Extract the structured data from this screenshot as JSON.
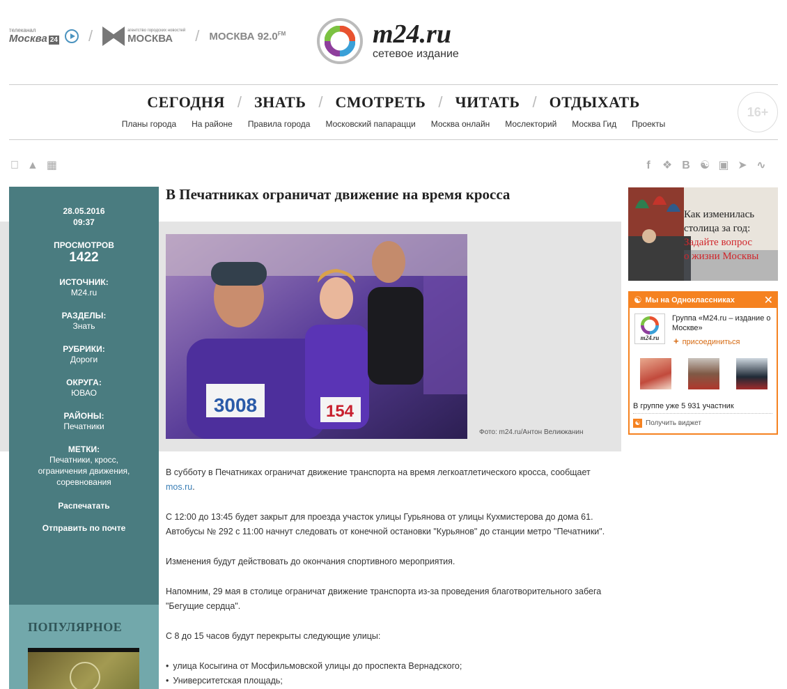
{
  "partners": {
    "tv_label": "телеканал",
    "tv_name": "Москва",
    "tv_num": "24",
    "agency_small": "агентство городских новостей",
    "agency_name": "МОСКВА",
    "radio_name": "МОСКВА 92.0",
    "radio_sup": "FM"
  },
  "logo": {
    "title": "m24.ru",
    "subtitle": "сетевое издание"
  },
  "nav": {
    "main": [
      "СЕГОДНЯ",
      "ЗНАТЬ",
      "СМОТРЕТЬ",
      "ЧИТАТЬ",
      "ОТДЫХАТЬ"
    ],
    "sub": [
      "Планы города",
      "На районе",
      "Правила города",
      "Московский папарацци",
      "Москва онлайн",
      "Мослекторий",
      "Москва Гид",
      "Проекты"
    ],
    "age_rating": "16+"
  },
  "icons": {
    "os": [
      "apple-icon",
      "android-icon",
      "windows-icon"
    ],
    "social": [
      "facebook-icon",
      "twitter-icon",
      "vk-icon",
      "odnoklassniki-icon",
      "instagram-icon",
      "telegram-icon",
      "rss-icon"
    ]
  },
  "meta": {
    "date": "28.05.2016",
    "time": "09:37",
    "views_label": "ПРОСМОТРОВ",
    "views": "1422",
    "source_label": "ИСТОЧНИК:",
    "source": "M24.ru",
    "sections_label": "РАЗДЕЛЫ:",
    "sections": "Знать",
    "rubrics_label": "РУБРИКИ:",
    "rubrics": "Дороги",
    "districts_label": "ОКРУГА:",
    "districts": "ЮВАО",
    "areas_label": "РАЙОНЫ:",
    "areas": "Печатники",
    "tags_label": "МЕТКИ:",
    "tags": "Печатники, кросс, ограничения движения, соревнования",
    "print": "Распечатать",
    "email": "Отправить по почте"
  },
  "popular": {
    "title": "ПОПУЛЯРНОЕ"
  },
  "article": {
    "title": "В Печатниках ограничат движение на время кросса",
    "photo_caption": "Фото: m24.ru/Антон Великжанин",
    "bib_numbers": [
      "3008",
      "154"
    ],
    "p1": "В субботу в Печатниках ограничат движение транспорта на время легкоатлетического кросса, сообщает",
    "p1_link": "mos.ru",
    "p1_end": ".",
    "p2": "С 12:00 до 13:45 будет закрыт для проезда участок улицы Гурьянова от улицы Кухмистерова до дома 61. Автобусы № 292 с 11:00 начнут следовать от конечной остановки \"Курьянов\" до станции метро \"Печатники\".",
    "p3": "Изменения будут действовать до окончания спортивного мероприятия.",
    "p4": "Напомним, 29 мая в столице ограничат движение транспорта из-за проведения благотворительного забега \"Бегущие сердца\".",
    "p5": "С 8 до 15 часов будут перекрыты следующие улицы:",
    "list": [
      "улица Косыгина от Мосфильмовской улицы до проспекта Вернадского;",
      "Университетская площадь;"
    ]
  },
  "promo": {
    "line1": "Как изменилась",
    "line2": "столица за год:",
    "line3": "Задайте вопрос",
    "line4": "о жизни Москвы"
  },
  "ok_widget": {
    "title": "Мы на Одноклассниках",
    "group_logo": "m24.ru",
    "group_name": "Группа «M24.ru – издание о Москве»",
    "join": "присоединиться",
    "members": "В группе уже 5 931 участник",
    "get_widget": "Получить виджет"
  },
  "colors": {
    "teal": "#4a7c80",
    "teal_light": "#72a8ab",
    "ok_orange": "#f58220",
    "link": "#3b7fb6",
    "promo_red": "#d0262b"
  }
}
